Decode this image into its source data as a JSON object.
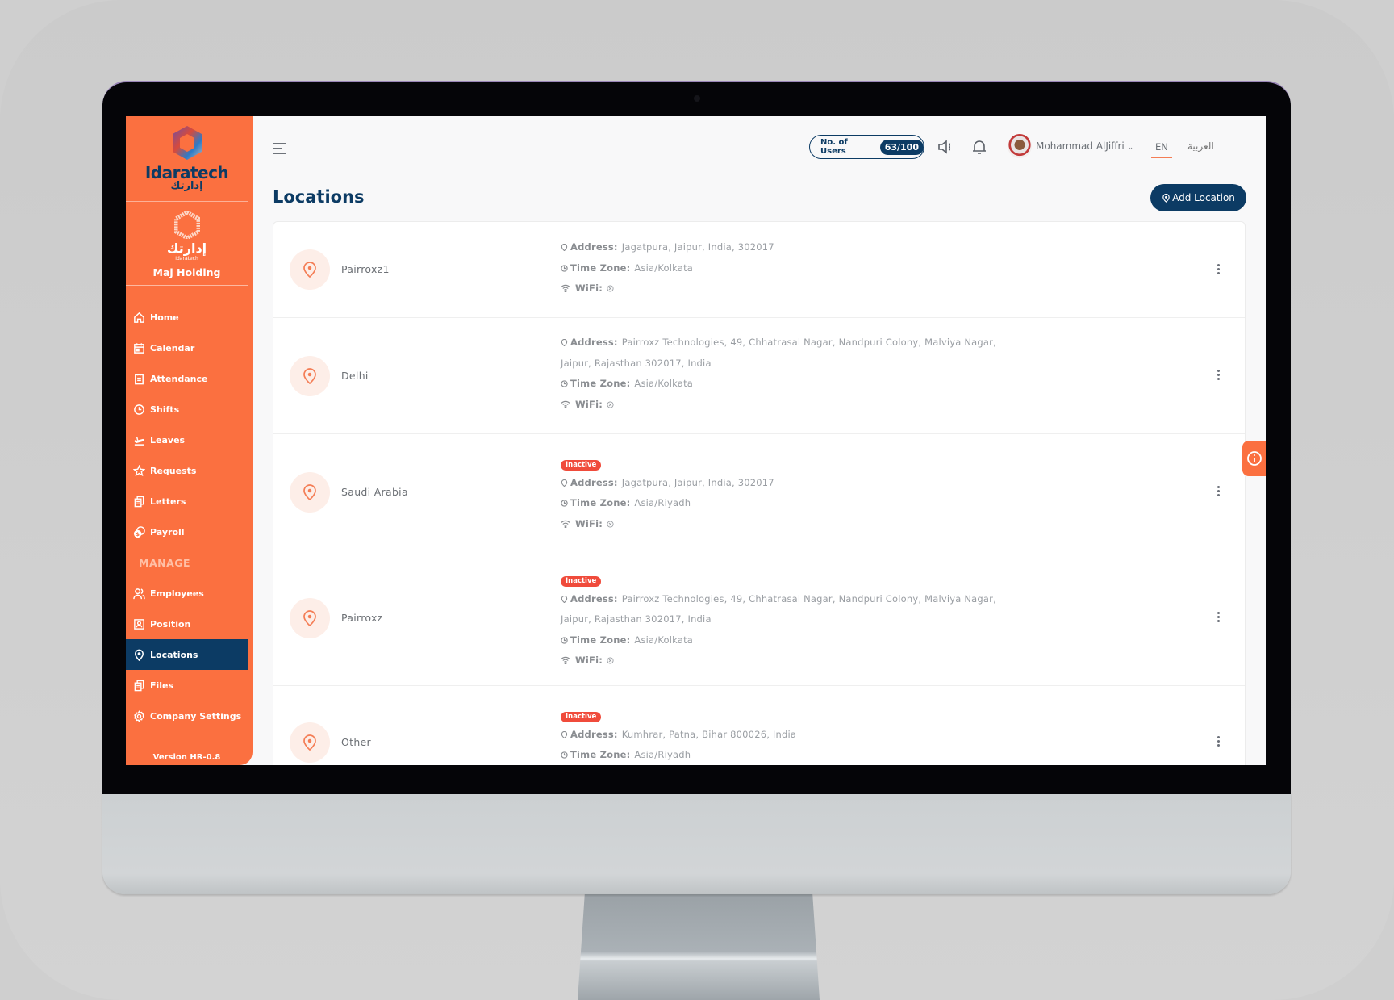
{
  "brand": {
    "name": "Idaratech",
    "name_ar": "إدارتك"
  },
  "company": {
    "logo_ar": "إدارتك",
    "logo_en": "Idaratech",
    "name": "Maj Holding"
  },
  "sidebar": {
    "items": [
      {
        "label": "Home",
        "icon": "home-icon"
      },
      {
        "label": "Calendar",
        "icon": "calendar-icon"
      },
      {
        "label": "Attendance",
        "icon": "clipboard-icon"
      },
      {
        "label": "Shifts",
        "icon": "clock-icon"
      },
      {
        "label": "Leaves",
        "icon": "plane-departure-icon"
      },
      {
        "label": "Requests",
        "icon": "star-icon"
      },
      {
        "label": "Letters",
        "icon": "documents-icon"
      },
      {
        "label": "Payroll",
        "icon": "coins-icon"
      }
    ],
    "section_label": "MANAGE",
    "manage_items": [
      {
        "label": "Employees",
        "icon": "users-icon"
      },
      {
        "label": "Position",
        "icon": "id-badge-icon"
      },
      {
        "label": "Locations",
        "icon": "map-pin-icon",
        "active": true
      },
      {
        "label": "Files",
        "icon": "files-icon"
      },
      {
        "label": "Company Settings",
        "icon": "gear-icon"
      }
    ],
    "version": "Version HR-0.8"
  },
  "header": {
    "users_label": "No. of Users",
    "users_count": "63/100",
    "user_name": "Mohammad AlJiffri",
    "lang_en": "EN",
    "lang_ar": "العربية"
  },
  "page": {
    "title": "Locations",
    "add_button": "Add Location"
  },
  "labels": {
    "address": "Address:",
    "time_zone": "Time Zone:",
    "wifi": "WiFi:"
  },
  "locations": [
    {
      "name": "Pairroxz1",
      "status": "",
      "address_line1": "Jagatpura, Jaipur, India, 302017",
      "address_line2": "",
      "time_zone": "Asia/Kolkata",
      "wifi": "none"
    },
    {
      "name": "Delhi",
      "status": "",
      "address_line1": "Pairroxz Technologies, 49, Chhatrasal Nagar, Nandpuri Colony, Malviya Nagar,",
      "address_line2": "Jaipur, Rajasthan 302017, India",
      "time_zone": "Asia/Kolkata",
      "wifi": "none"
    },
    {
      "name": "Saudi Arabia",
      "status": "Inactive",
      "address_line1": "Jagatpura, Jaipur, India, 302017",
      "address_line2": "",
      "time_zone": "Asia/Riyadh",
      "wifi": "none"
    },
    {
      "name": "Pairroxz",
      "status": "Inactive",
      "address_line1": "Pairroxz Technologies, 49, Chhatrasal Nagar, Nandpuri Colony, Malviya Nagar,",
      "address_line2": "Jaipur, Rajasthan 302017, India",
      "time_zone": "Asia/Kolkata",
      "wifi": "none"
    },
    {
      "name": "Other",
      "status": "Inactive",
      "address_line1": "Kumhrar, Patna, Bihar 800026, India",
      "address_line2": "",
      "time_zone": "Asia/Riyadh",
      "wifi": ""
    }
  ],
  "colors": {
    "sidebar": "#fb7040",
    "primary": "#0c3b64",
    "inactive": "#f04b3b",
    "accent": "#f47d55"
  }
}
